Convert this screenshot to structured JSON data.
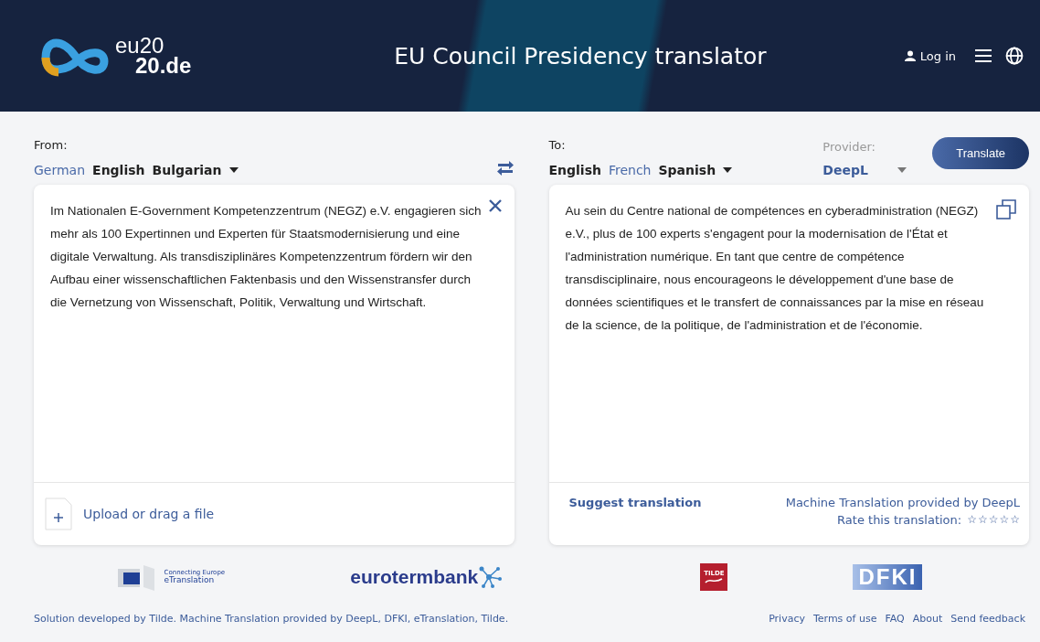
{
  "header": {
    "logo_line1": "eu20",
    "logo_line2": "20.de",
    "title": "EU Council Presidency translator",
    "login": "Log in"
  },
  "source": {
    "label": "From:",
    "languages": [
      {
        "name": "German",
        "selected": true
      },
      {
        "name": "English",
        "selected": false
      },
      {
        "name": "Bulgarian",
        "selected": false
      }
    ],
    "text": "Im Nationalen E-Government Kompetenzzentrum (NEGZ) e.V. engagieren sich mehr als 100 Expertinnen und Experten für Staatsmodernisierung und eine digitale Verwaltung. Als transdisziplinäres Kompetenzzentrum fördern wir den Aufbau einer wissenschaftlichen Faktenbasis und den Wissenstransfer durch die Vernetzung von Wissenschaft, Politik, Verwaltung und Wirtschaft.",
    "upload": "Upload or drag a file"
  },
  "target": {
    "label": "To:",
    "languages": [
      {
        "name": "English",
        "selected": false
      },
      {
        "name": "French",
        "selected": true
      },
      {
        "name": "Spanish",
        "selected": false
      }
    ],
    "provider_label": "Provider:",
    "provider": "DeepL",
    "translate_button": "Translate",
    "text": "Au sein du Centre national de compétences en cyberadministration (NEGZ) e.V., plus de 100 experts s'engagent pour la modernisation de l'État et l'administration numérique. En tant que centre de compétence transdisciplinaire, nous encourageons le développement d'une base de données scientifiques et le transfert de connaissances par la mise en réseau de la science, de la politique, de l'administration et de l'économie.",
    "suggest": "Suggest translation",
    "provided_by": "Machine Translation provided by DeepL",
    "rate_label": "Rate this translation:",
    "stars": 0
  },
  "partners": {
    "etranslation_small": "Connecting Europe",
    "etranslation": "eTranslation",
    "eurotermbank": "eurotermbank",
    "tilde": "TILDE",
    "dfki": "DFKI"
  },
  "footer": {
    "credits": "Solution developed by Tilde. Machine Translation provided by DeepL, DFKI, eTranslation, Tilde.",
    "links": [
      "Privacy",
      "Terms of use",
      "FAQ",
      "About",
      "Send feedback"
    ]
  }
}
